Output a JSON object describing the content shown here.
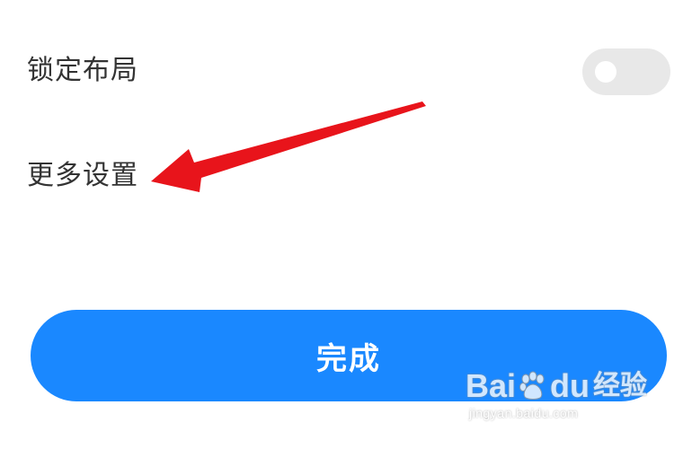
{
  "settings": {
    "lock_layout_label": "锁定布局",
    "lock_layout_enabled": false,
    "more_settings_label": "更多设置"
  },
  "actions": {
    "done_label": "完成"
  },
  "watermark": {
    "brand_left": "Bai",
    "brand_right": "du",
    "jingyan": "经验",
    "url": "jingyan.baidu.com"
  },
  "colors": {
    "accent": "#1a88ff",
    "annotation_arrow": "#e8141b",
    "toggle_off": "#e8e8e8"
  },
  "annotation": {
    "icon": "red-arrow-pointing-left"
  }
}
